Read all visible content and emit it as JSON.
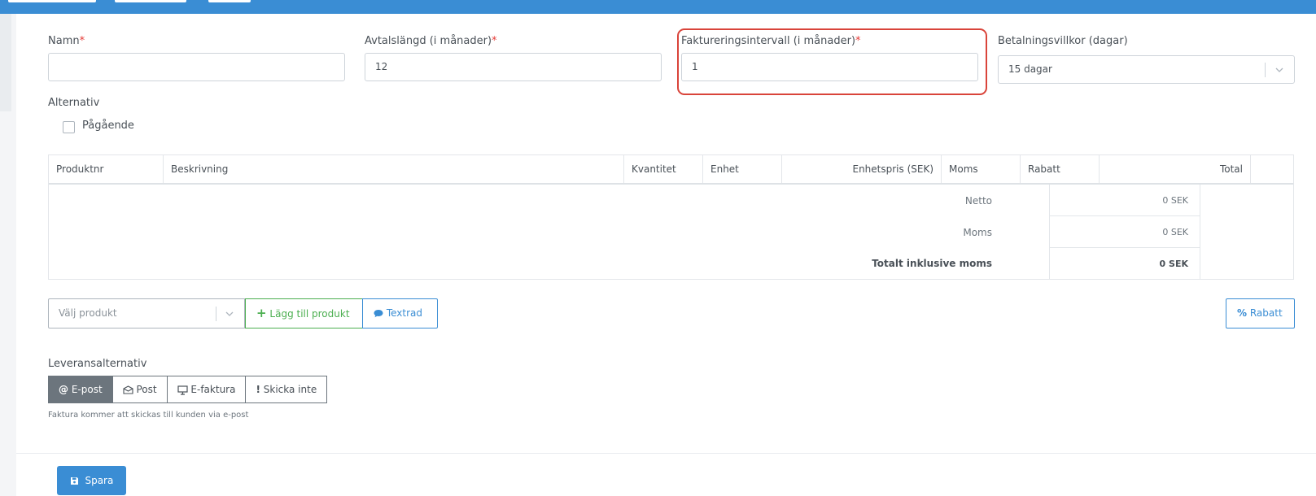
{
  "form": {
    "name": {
      "label": "Namn",
      "required_mark": "*",
      "value": ""
    },
    "contract_length": {
      "label": "Avtalslängd (i månader)",
      "required_mark": "*",
      "value": "12"
    },
    "billing_interval": {
      "label": "Faktureringsintervall (i månader)",
      "required_mark": "*",
      "value": "1"
    },
    "payment_terms": {
      "label": "Betalningsvillkor (dagar)",
      "value": "15 dagar"
    },
    "options": {
      "label": "Alternativ",
      "ongoing_label": "Pågående",
      "ongoing_checked": false
    }
  },
  "table": {
    "columns": [
      "Produktnr",
      "Beskrivning",
      "Kvantitet",
      "Enhet",
      "Enhetspris (SEK)",
      "Moms",
      "Rabatt",
      "Total"
    ],
    "summary": [
      {
        "label": "Netto",
        "value": "0 SEK"
      },
      {
        "label": "Moms",
        "value": "0 SEK"
      },
      {
        "label": "Totalt inklusive moms",
        "value": "0 SEK"
      }
    ]
  },
  "actions": {
    "product_placeholder": "Välj produkt",
    "add_product": "Lägg till produkt",
    "text_row": "Textrad",
    "discount": "Rabatt"
  },
  "delivery": {
    "label": "Leveransalternativ",
    "options": [
      "E-post",
      "Post",
      "E-faktura",
      "Skicka inte"
    ],
    "selected": "E-post",
    "note": "Faktura kommer att skickas till kunden via e-post"
  },
  "save_label": "Spara",
  "colors": {
    "primary": "#3a8dd4",
    "success": "#4caf50",
    "danger": "#e53935",
    "highlight": "#d9443a",
    "active_seg": "#6c757d"
  }
}
